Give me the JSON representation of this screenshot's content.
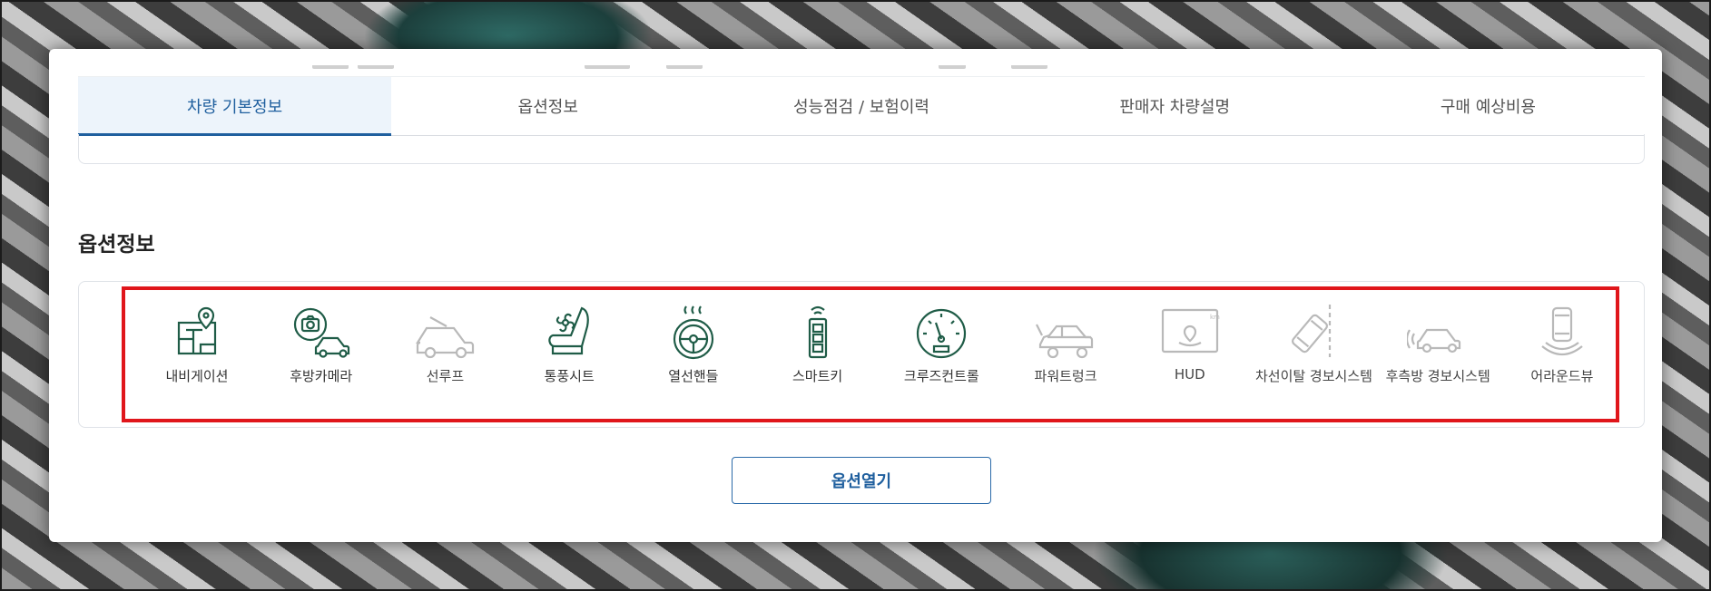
{
  "tabs": [
    {
      "label": "차량 기본정보",
      "active": true
    },
    {
      "label": "옵션정보",
      "active": false
    },
    {
      "label": "성능점검 / 보험이력",
      "active": false
    },
    {
      "label": "판매자 차량설명",
      "active": false
    },
    {
      "label": "구매 예상비용",
      "active": false
    }
  ],
  "section": {
    "title": "옵션정보"
  },
  "options": [
    {
      "label": "내비게이션",
      "icon": "navigation-map-icon",
      "available": true
    },
    {
      "label": "후방카메라",
      "icon": "rear-camera-car-icon",
      "available": true
    },
    {
      "label": "선루프",
      "icon": "sunroof-car-icon",
      "available": false
    },
    {
      "label": "통풍시트",
      "icon": "ventilated-seat-icon",
      "available": true
    },
    {
      "label": "열선핸들",
      "icon": "heated-steering-wheel-icon",
      "available": true
    },
    {
      "label": "스마트키",
      "icon": "smart-key-icon",
      "available": true
    },
    {
      "label": "크루즈컨트롤",
      "icon": "speedometer-icon",
      "available": true
    },
    {
      "label": "파워트렁크",
      "icon": "power-trunk-car-icon",
      "available": false
    },
    {
      "label": "HUD",
      "icon": "hud-display-icon",
      "available": false
    },
    {
      "label": "차선이탈 경보시스템",
      "icon": "lane-departure-icon",
      "available": false
    },
    {
      "label": "후측방 경보시스템",
      "icon": "blind-spot-car-icon",
      "available": false
    },
    {
      "label": "어라운드뷰",
      "icon": "around-view-icon",
      "available": false
    }
  ],
  "open_button": {
    "label": "옵션열기"
  },
  "colors": {
    "active_icon": "#1f5c47",
    "inactive_icon": "#b9b9b9",
    "accent": "#1f5f9e",
    "highlight": "#e0161b"
  }
}
